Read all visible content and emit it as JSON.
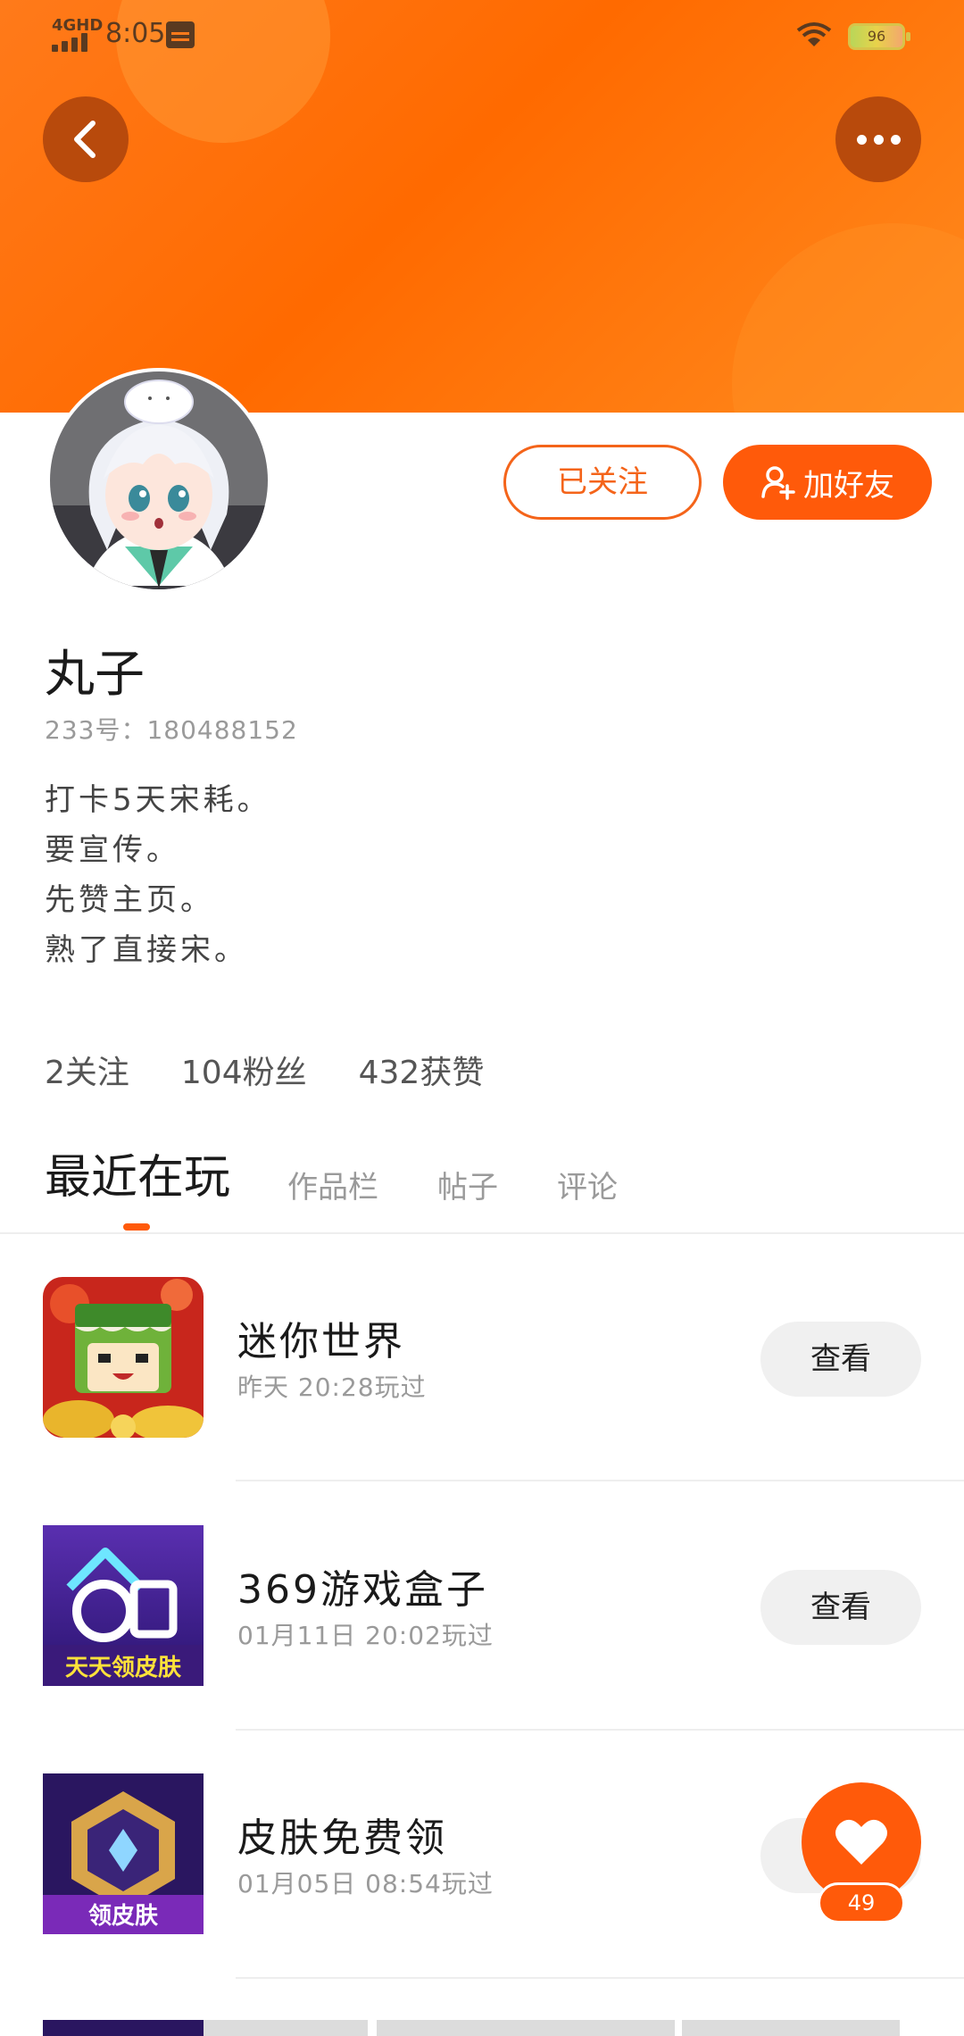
{
  "status_bar": {
    "network": "4GHD",
    "time": "8:05",
    "battery": "96"
  },
  "header": {
    "back_icon": "back-icon",
    "more_icon": "more-icon"
  },
  "profile": {
    "name": "丸子",
    "uid_line": "233号：180488152",
    "bio": [
      "打卡5天宋耗。",
      "要宣传。",
      "先赞主页。",
      "熟了直接宋。"
    ],
    "follow_label": "已关注",
    "add_friend_label": "加好友"
  },
  "stats": {
    "following": "2关注",
    "fans": "104粉丝",
    "likes": "432获赞"
  },
  "tabs": [
    "最近在玩",
    "作品栏",
    "帖子",
    "评论"
  ],
  "games": [
    {
      "name": "迷你世界",
      "time": "昨天 20:28玩过",
      "button": "查看"
    },
    {
      "name": "369游戏盒子",
      "time": "01月11日 20:02玩过",
      "button": "查看"
    },
    {
      "name": "皮肤免费领",
      "time": "01月05日 08:54玩过",
      "button": "查看"
    }
  ],
  "game_icon_text": {
    "g2": "天天领皮肤",
    "g3": "领皮肤"
  },
  "fab": {
    "count": "49"
  },
  "colors": {
    "accent": "#ff5a0a",
    "banner": "#ff7a1a"
  }
}
